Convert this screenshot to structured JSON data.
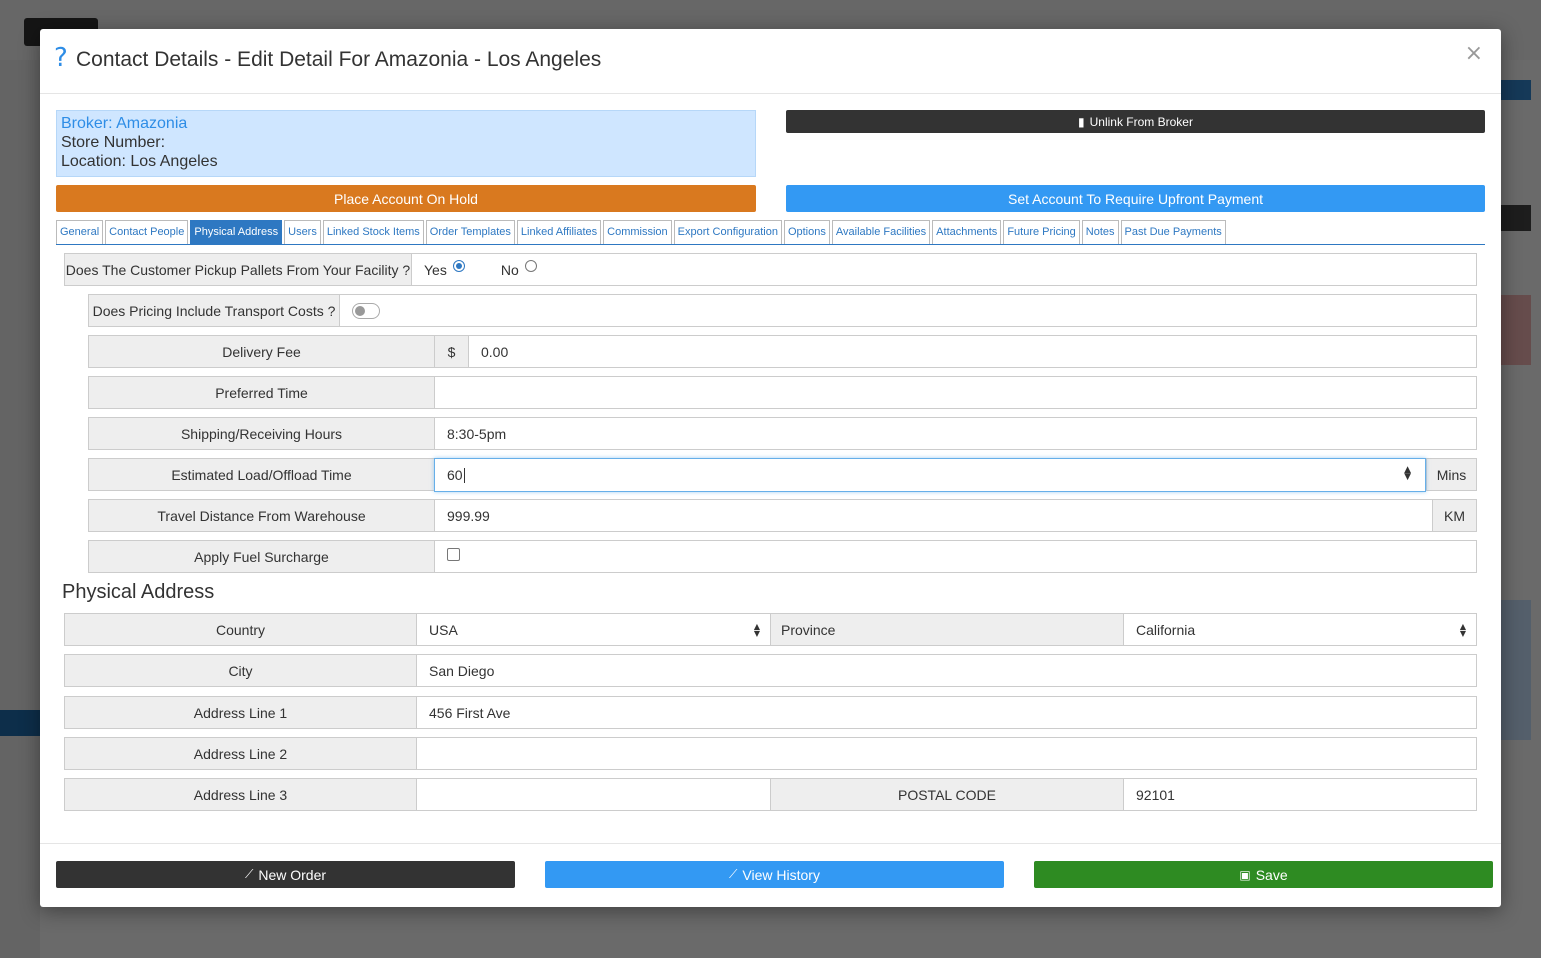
{
  "modal": {
    "title": "Contact Details - Edit Detail For Amazonia - Los Angeles",
    "close_glyph": "×"
  },
  "info": {
    "broker": "Broker: Amazonia",
    "store_number": "Store Number:",
    "location": "Location: Los Angeles"
  },
  "buttons": {
    "unlink": "Unlink From Broker",
    "hold": "Place Account On Hold",
    "upfront": "Set Account To Require Upfront Payment"
  },
  "tabs": [
    {
      "label": "General"
    },
    {
      "label": "Contact People"
    },
    {
      "label": "Physical Address"
    },
    {
      "label": "Users"
    },
    {
      "label": "Linked Stock Items"
    },
    {
      "label": "Order Templates"
    },
    {
      "label": "Linked Affiliates"
    },
    {
      "label": "Commission"
    },
    {
      "label": "Export Configuration"
    },
    {
      "label": "Options"
    },
    {
      "label": "Available Facilities"
    },
    {
      "label": "Attachments"
    },
    {
      "label": "Future Pricing"
    },
    {
      "label": "Notes"
    },
    {
      "label": "Past Due Payments"
    }
  ],
  "active_tab": "Physical Address",
  "pickup": {
    "label": "Does The Customer Pickup Pallets From Your Facility ?",
    "yes": "Yes",
    "no": "No",
    "selected": "Yes"
  },
  "transport": {
    "label": "Does Pricing Include Transport Costs ?",
    "enabled": false
  },
  "delivery_fee": {
    "label": "Delivery Fee",
    "currency": "$",
    "value": "0.00"
  },
  "preferred_time": {
    "label": "Preferred Time",
    "value": ""
  },
  "shipping_hours": {
    "label": "Shipping/Receiving Hours",
    "value": "8:30-5pm"
  },
  "load_time": {
    "label": "Estimated Load/Offload Time",
    "value": "60",
    "unit": "Mins"
  },
  "travel_distance": {
    "label": "Travel Distance From Warehouse",
    "value": "999.99",
    "unit": "KM"
  },
  "fuel_surcharge": {
    "label": "Apply Fuel Surcharge",
    "checked": false
  },
  "address": {
    "section_title": "Physical Address",
    "country_label": "Country",
    "country": "USA",
    "province_label": "Province",
    "province": "California",
    "city_label": "City",
    "city": "San Diego",
    "line1_label": "Address Line 1",
    "line1": "456 First Ave",
    "line2_label": "Address Line 2",
    "line2": "",
    "line3_label": "Address Line 3",
    "line3": "",
    "postal_label": "POSTAL CODE",
    "postal": "92101"
  },
  "footer": {
    "new_order": "New Order",
    "view_history": "View History",
    "save": "Save"
  },
  "colors": {
    "primary": "#3399f3",
    "tab_active": "#2e78c2",
    "hold": "#d9791f",
    "save": "#2e8b22",
    "dark": "#333333"
  }
}
